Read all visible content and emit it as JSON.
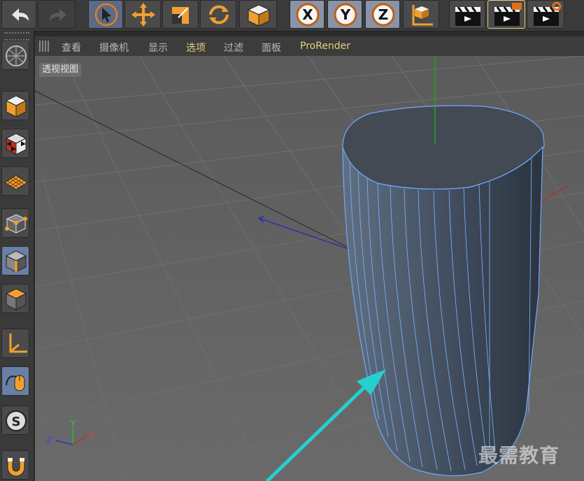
{
  "toolbar": {
    "buttons": [
      {
        "name": "undo-button",
        "icon": "undo-icon"
      },
      {
        "name": "redo-button",
        "icon": "redo-icon"
      },
      {
        "name": "select-tool-button",
        "icon": "cursor-icon"
      },
      {
        "name": "move-tool-button",
        "icon": "move-icon"
      },
      {
        "name": "scale-tool-button",
        "icon": "scale-icon"
      },
      {
        "name": "rotate-tool-button",
        "icon": "rotate-icon"
      },
      {
        "name": "object-mode-button",
        "icon": "cube-icon"
      },
      {
        "name": "x-axis-button",
        "icon": "x-axis-icon",
        "label": "X"
      },
      {
        "name": "y-axis-button",
        "icon": "y-axis-icon",
        "label": "Y"
      },
      {
        "name": "z-axis-button",
        "icon": "z-axis-icon",
        "label": "Z"
      },
      {
        "name": "coordinate-system-button",
        "icon": "coordinate-icon"
      },
      {
        "name": "render-view-button",
        "icon": "clapper-icon"
      },
      {
        "name": "render-picture-viewer-button",
        "icon": "clapper-icon"
      },
      {
        "name": "edit-render-settings-button",
        "icon": "clapper-gear-icon"
      }
    ]
  },
  "viewport_menu": {
    "items": [
      "查看",
      "摄像机",
      "显示",
      "选项",
      "过滤",
      "面板",
      "ProRender"
    ],
    "active_index": 3
  },
  "viewport": {
    "label": "透视视图",
    "axis_labels": {
      "y": "Y",
      "x": "X",
      "z": "Z"
    }
  },
  "left_toolbar": {
    "buttons": [
      {
        "name": "display-filter-button",
        "icon": "globe-grid-icon"
      },
      {
        "name": "model-mode-button",
        "icon": "cube-icon"
      },
      {
        "name": "texture-mode-button",
        "icon": "checker-cube-icon"
      },
      {
        "name": "workplane-mode-button",
        "icon": "grid-plane-icon"
      },
      {
        "name": "points-mode-button",
        "icon": "vertex-cube-icon"
      },
      {
        "name": "edges-mode-button",
        "icon": "edge-cube-icon"
      },
      {
        "name": "polygons-mode-button",
        "icon": "polygon-cube-icon"
      },
      {
        "name": "axis-mode-button",
        "icon": "axis-icon"
      },
      {
        "name": "tweak-mode-button",
        "icon": "mouse-icon"
      },
      {
        "name": "snap-button",
        "icon": "snap-icon"
      },
      {
        "name": "workplane-lock-button",
        "icon": "magnet-icon"
      }
    ]
  },
  "watermark": "最需教育",
  "colors": {
    "accent": "#f0a030",
    "selection": "#6fa8ff",
    "menu_active": "#e6cf7a",
    "arrow": "#25d0d0"
  }
}
